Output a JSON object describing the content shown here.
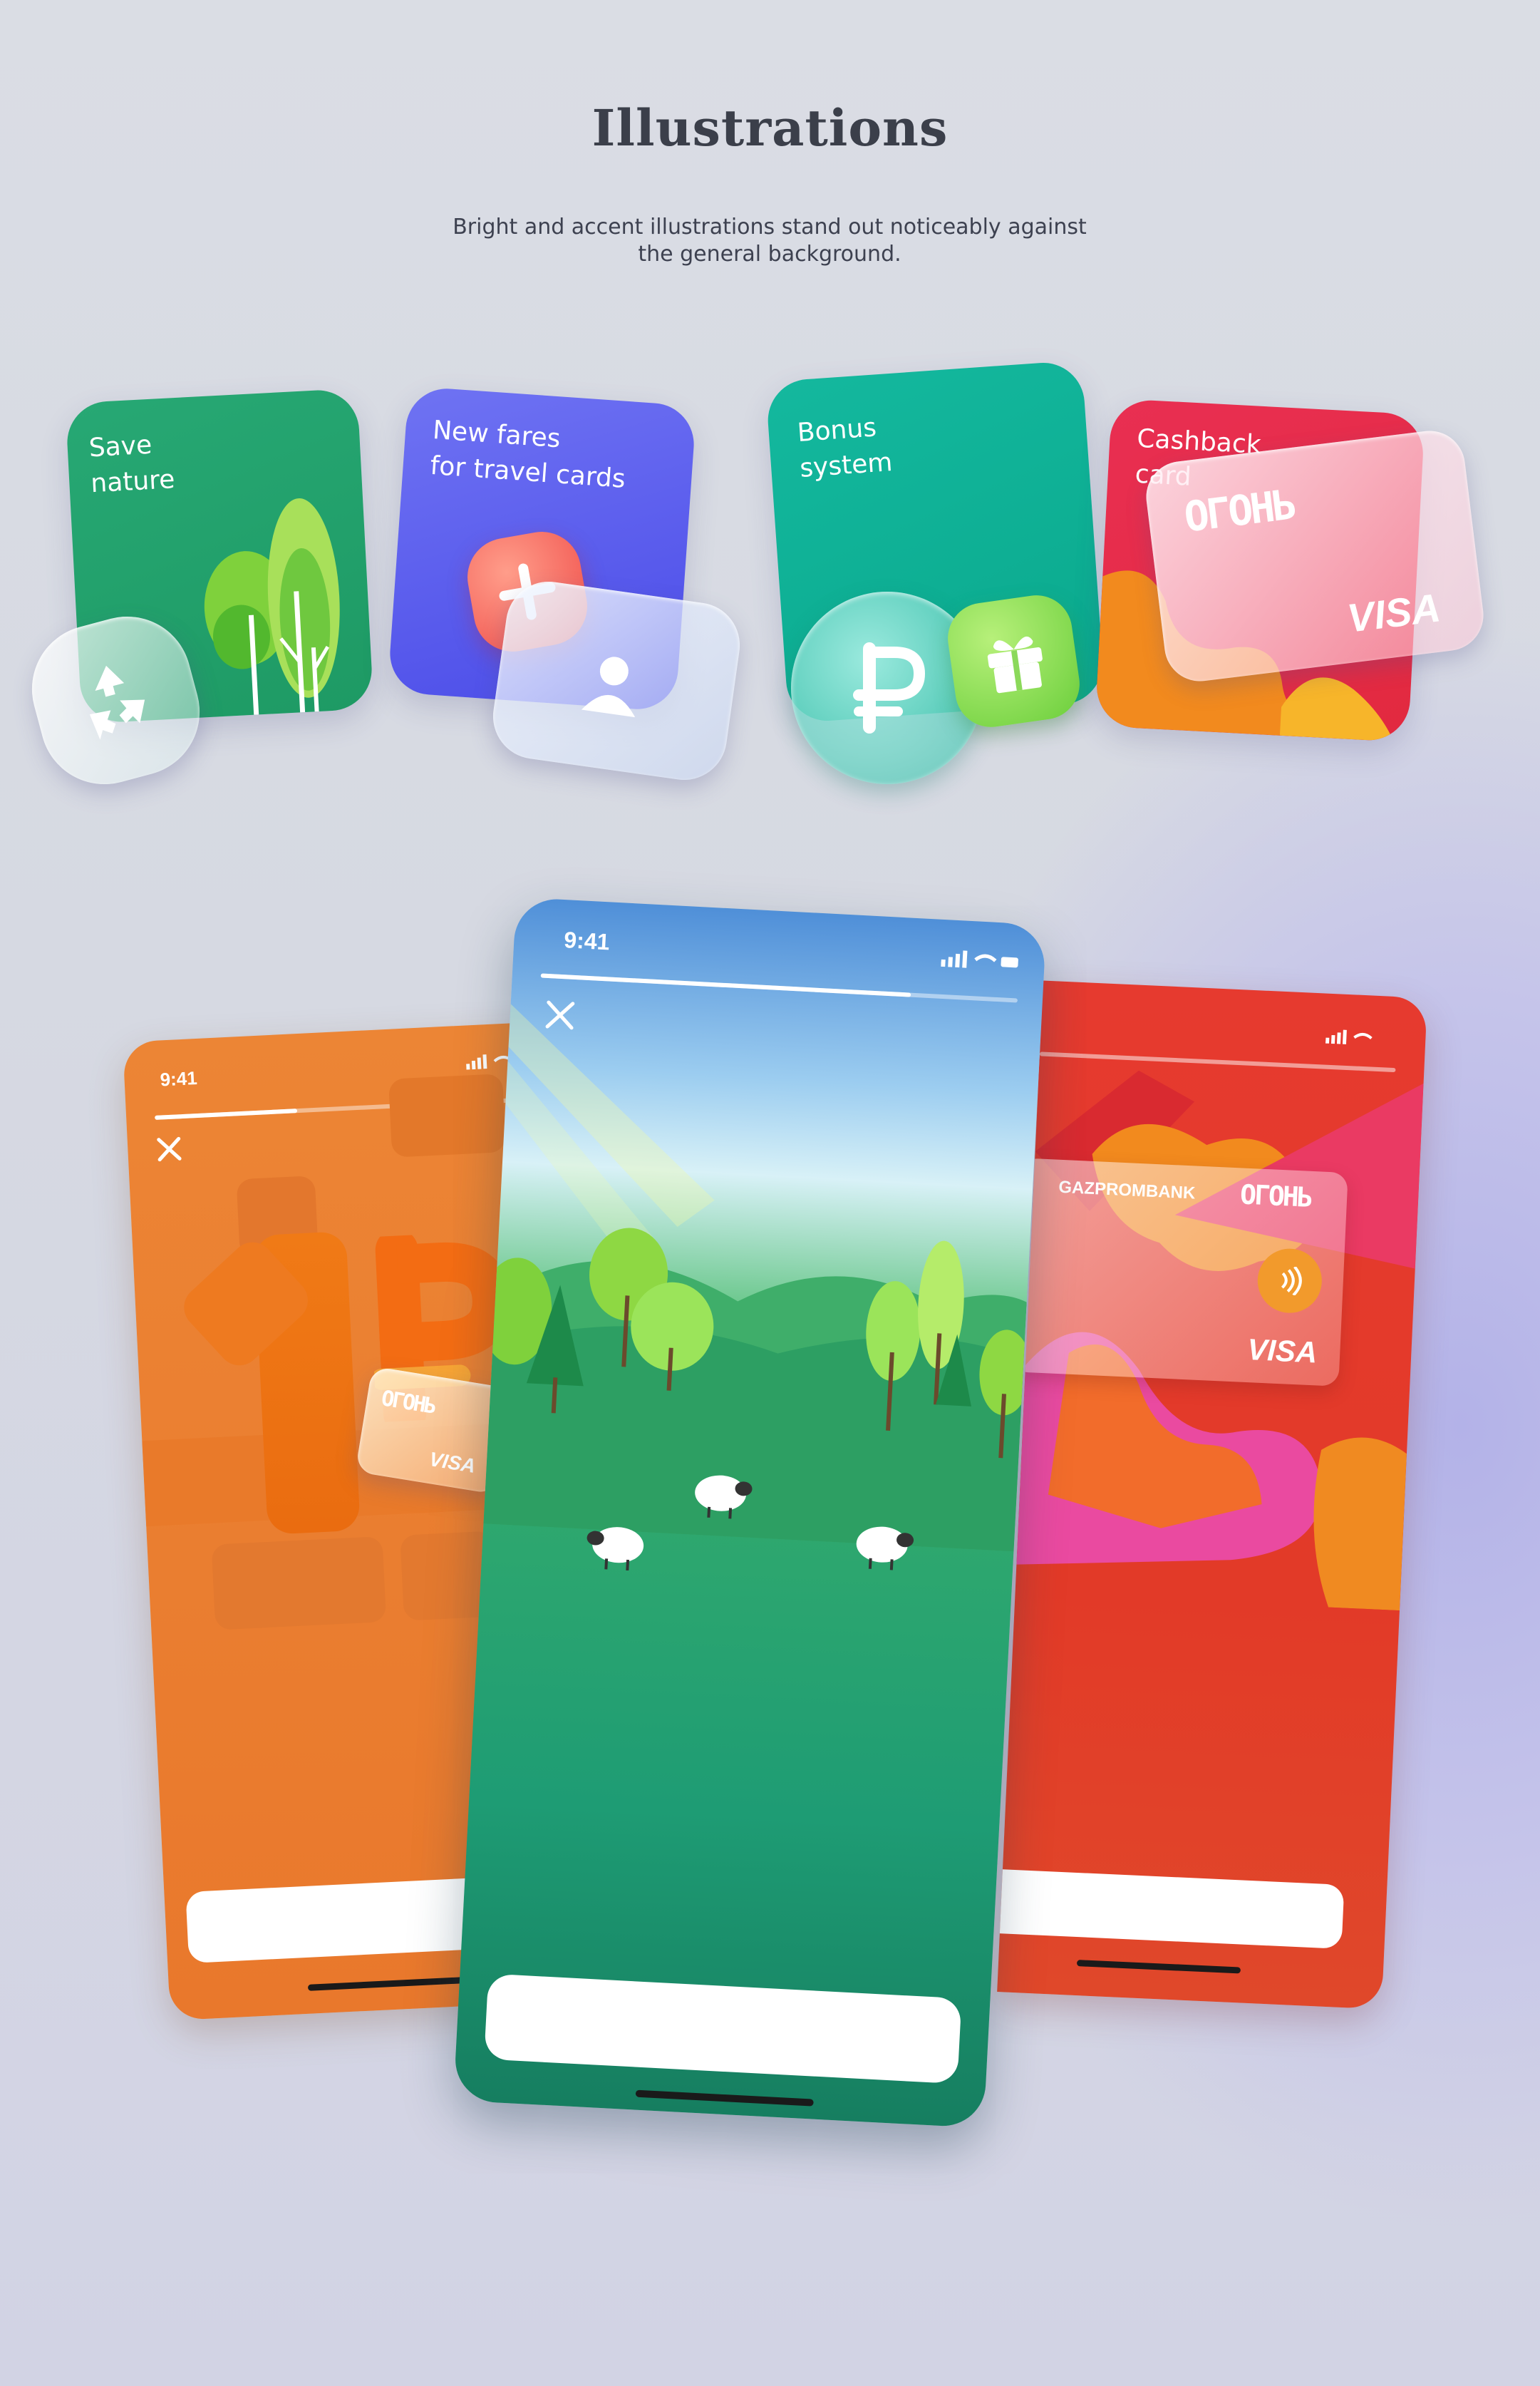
{
  "header": {
    "title": "Illustrations",
    "subtitle_line1": "Bright and accent illustrations stand out noticeably against",
    "subtitle_line2": "the general background."
  },
  "tiles": [
    {
      "label_line1": "Save",
      "label_line2": "nature",
      "color": "#22a36e",
      "icon": "recycle-icon"
    },
    {
      "label_line1": "New fares",
      "label_line2": "for travel cards",
      "color": "#5a5cf0",
      "icon": "add-user-icon"
    },
    {
      "label_line1": "Bonus",
      "label_line2": "system",
      "color": "#13b49a",
      "icon": "ruble-icon"
    },
    {
      "label_line1": "Cashback",
      "label_line2": "card",
      "color": "#e8344e",
      "icon": "card-icon"
    }
  ],
  "card_brand": "ОГОНЬ",
  "card_network": "VISA",
  "bank_name": "GAZPROMBANK",
  "phones": {
    "left": {
      "time": "9:41",
      "color": "#ec8535",
      "icon": "close-icon"
    },
    "center": {
      "time": "9:41",
      "color": "#1e9c74",
      "icon": "close-icon"
    },
    "right": {
      "color": "#e34a2d"
    }
  },
  "colors": {
    "accent_green": "#22a36e",
    "accent_violet": "#5a5cf0",
    "accent_teal": "#13b49a",
    "accent_red": "#e8344e",
    "orange": "#ec8535"
  }
}
